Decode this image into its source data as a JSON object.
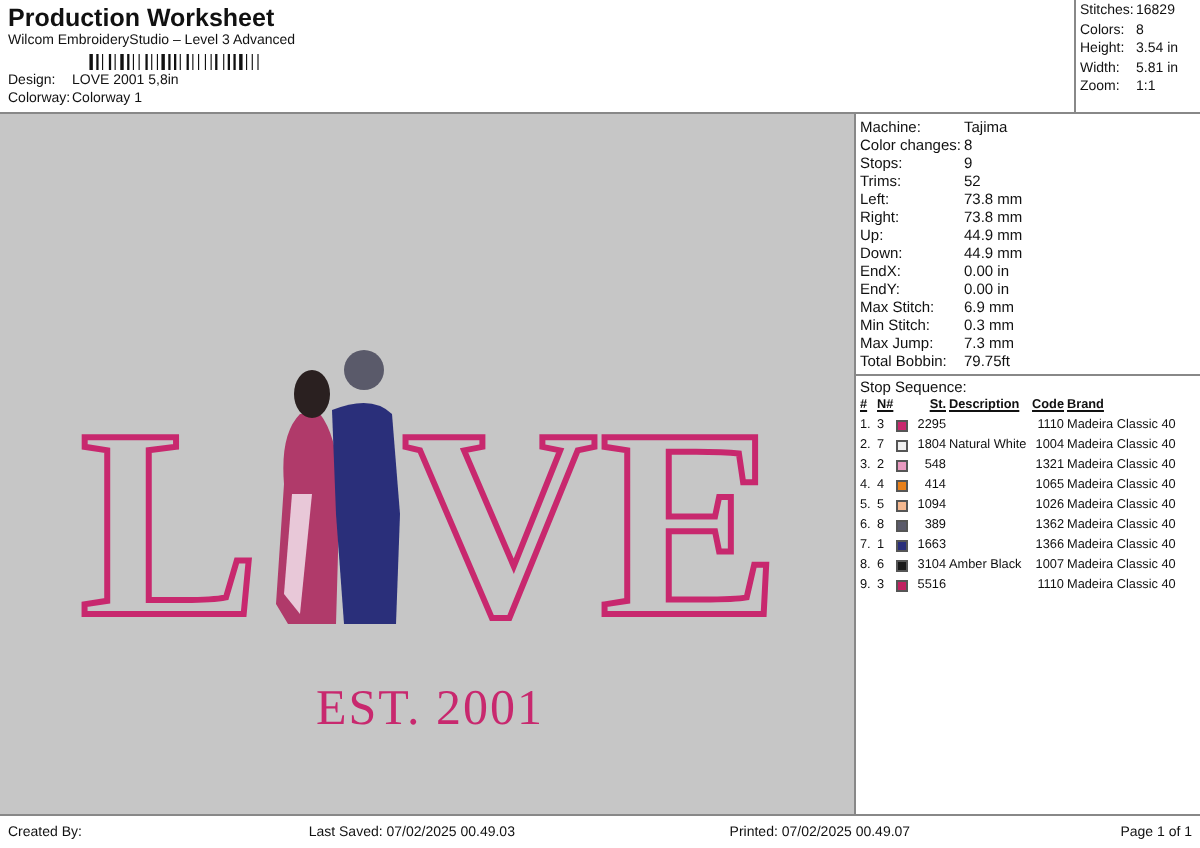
{
  "header": {
    "title": "Production Worksheet",
    "subtitle": "Wilcom EmbroideryStudio – Level 3 Advanced",
    "fields": [
      {
        "label": "Design:",
        "value": "LOVE 2001 5,8in"
      },
      {
        "label": "Colorway:",
        "value": "Colorway 1"
      }
    ]
  },
  "summary": [
    {
      "label": "Stitches:",
      "value": "16829"
    },
    {
      "label": "Colors:",
      "value": "8"
    },
    {
      "label": "Height:",
      "value": "3.54 in"
    },
    {
      "label": "Width:",
      "value": "5.81 in"
    },
    {
      "label": "Zoom:",
      "value": "1:1"
    }
  ],
  "design": {
    "letters": [
      "L",
      "V",
      "E"
    ],
    "tagline": "EST. 2001"
  },
  "machine_info": [
    {
      "label": "Machine:",
      "value": "Tajima"
    },
    {
      "label": "Color changes:",
      "value": "8"
    },
    {
      "label": "Stops:",
      "value": "9"
    },
    {
      "label": "Trims:",
      "value": "52"
    },
    {
      "label": "Left:",
      "value": "73.8 mm"
    },
    {
      "label": "Right:",
      "value": "73.8 mm"
    },
    {
      "label": "Up:",
      "value": "44.9 mm"
    },
    {
      "label": "Down:",
      "value": "44.9 mm"
    },
    {
      "label": "EndX:",
      "value": "0.00 in"
    },
    {
      "label": "EndY:",
      "value": "0.00 in"
    },
    {
      "label": "Max Stitch:",
      "value": "6.9 mm"
    },
    {
      "label": "Min Stitch:",
      "value": "0.3 mm"
    },
    {
      "label": "Max Jump:",
      "value": "7.3 mm"
    },
    {
      "label": "Total Bobbin:",
      "value": "79.75ft"
    }
  ],
  "stop_sequence": {
    "title": "Stop Sequence:",
    "columns": [
      "#",
      "N#",
      "St.",
      "Description",
      "Code",
      "Brand"
    ],
    "rows": [
      {
        "index": "1.",
        "needle": "3",
        "color": "#c8286e",
        "stitches": "2295",
        "description": "",
        "code": "1110",
        "brand": "Madeira Classic 40"
      },
      {
        "index": "2.",
        "needle": "7",
        "color": "#f0f0f0",
        "stitches": "1804",
        "description": "Natural White",
        "code": "1004",
        "brand": "Madeira Classic 40"
      },
      {
        "index": "3.",
        "needle": "2",
        "color": "#e899c0",
        "stitches": "548",
        "description": "",
        "code": "1321",
        "brand": "Madeira Classic 40"
      },
      {
        "index": "4.",
        "needle": "4",
        "color": "#e8801a",
        "stitches": "414",
        "description": "",
        "code": "1065",
        "brand": "Madeira Classic 40"
      },
      {
        "index": "5.",
        "needle": "5",
        "color": "#f4b890",
        "stitches": "1094",
        "description": "",
        "code": "1026",
        "brand": "Madeira Classic 40"
      },
      {
        "index": "6.",
        "needle": "8",
        "color": "#5a5a6a",
        "stitches": "389",
        "description": "",
        "code": "1362",
        "brand": "Madeira Classic 40"
      },
      {
        "index": "7.",
        "needle": "1",
        "color": "#2a2f7a",
        "stitches": "1663",
        "description": "",
        "code": "1366",
        "brand": "Madeira Classic 40"
      },
      {
        "index": "8.",
        "needle": "6",
        "color": "#1a1a1a",
        "stitches": "3104",
        "description": "Amber Black",
        "code": "1007",
        "brand": "Madeira Classic 40"
      },
      {
        "index": "9.",
        "needle": "3",
        "color": "#c02060",
        "stitches": "5516",
        "description": "",
        "code": "1110",
        "brand": "Madeira Classic 40"
      }
    ]
  },
  "footer": {
    "created_by": "Created By:",
    "last_saved": "Last Saved: 07/02/2025 00.49.03",
    "printed": "Printed: 07/02/2025 00.49.07",
    "page": "Page 1 of 1"
  }
}
